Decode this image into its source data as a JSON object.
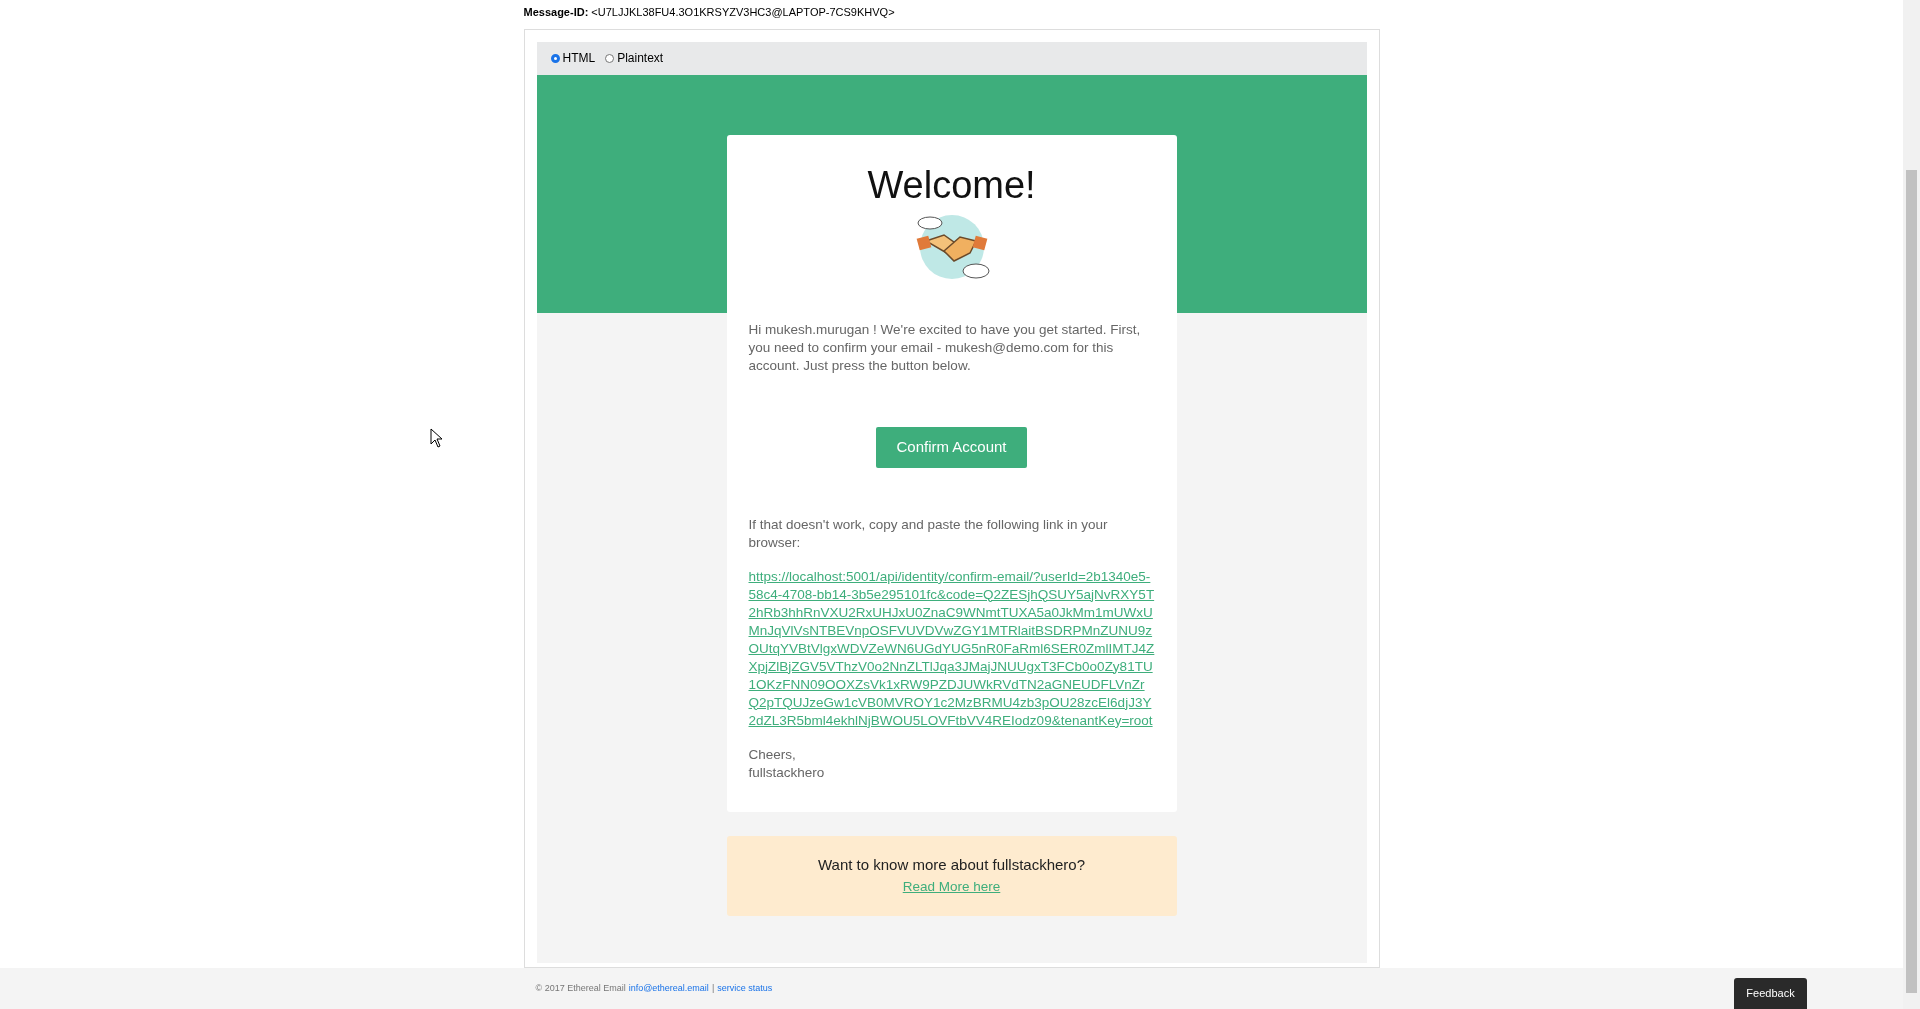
{
  "header": {
    "message_id_label": "Message-ID:",
    "message_id": "<U7LJJKL38FU4.3O1KRSYZV3HC3@LAPTOP-7CS9KHVQ>"
  },
  "view_options": [
    {
      "label": "HTML",
      "selected": true
    },
    {
      "label": "Plaintext",
      "selected": false
    }
  ],
  "email": {
    "title": "Welcome!",
    "intro": "Hi mukesh.murugan ! We're excited to have you get started. First, you need to confirm your email - mukesh@demo.com for this account. Just press the button below.",
    "button": "Confirm Account",
    "fallback": "If that doesn't work, copy and paste the following link in your browser:",
    "link": "https://localhost:5001/api/identity/confirm-email/?userId=2b1340e5-58c4-4708-bb14-3b5e295101fc&code=Q2ZESjhQSUY5ajNvRXY5T2hRb3hhRnVXU2RxUHJxU0ZnaC9WNmtTUXA5a0JkMm1mUWxUMnJqVlVsNTBEVnpOSFVUVDVwZGY1MTRlaitBSDRPMnZUNU9zOUtqYVBtVlgxWDVZeWN6UGdYUG5nR0FaRml6SER0ZmlIMTJ4ZXpjZlBjZGV5VThzV0o2NnZLTlJqa3JMajJNUUgxT3FCb0o0Zy81TU1OKzFNN09OOXZsVk1xRW9PZDJUWkRVdTN2aGNEUDFLVnZrQ2pTQUJzeGw1cVB0MVROY1c2MzBRMU4zb3pOU28zcEl6djJ3Y2dZL3R5bml4ekhlNjBWOU5LOVFtbVV4REIodz09&tenantKey=root",
    "signoff": [
      "Cheers,",
      "fullstackhero"
    ],
    "promo_text": "Want to know more about fullstackhero?",
    "promo_link": "Read More here"
  },
  "footer": {
    "copyright": "© 2017 Ethereal Email",
    "email_link": "info@ethereal.email",
    "separator": "|",
    "status_link": "service status"
  },
  "feedback_button": "Feedback"
}
